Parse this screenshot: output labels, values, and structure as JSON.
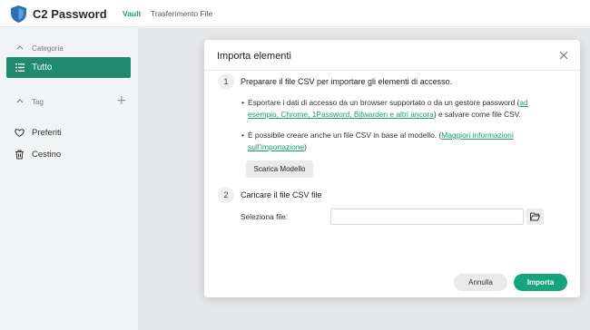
{
  "app": {
    "title": "C2 Password",
    "nav": [
      "Vault",
      "Trasferimento File"
    ]
  },
  "sidebar": {
    "category_header": "Categoria",
    "active_item": "Tutto",
    "tag_header": "Tag",
    "items": [
      {
        "label": "Preferiti",
        "icon": "heart-icon"
      },
      {
        "label": "Cestino",
        "icon": "trash-icon"
      }
    ]
  },
  "modal": {
    "title": "Importa elementi",
    "step1": {
      "num": "1",
      "title": "Preparare il file CSV per importare gli elementi di accesso.",
      "bullet1_pre": "Esportare i dati di accesso da un browser supportato o da un gestore password (",
      "bullet1_link": "ad esempio, Chrome, 1Password, Bitwarden e altri ancora",
      "bullet1_post": ") e salvare come file CSV.",
      "bullet2_pre": "È possibile creare anche un file CSV in base al modello. (",
      "bullet2_link": "Maggiori informazioni sull'importazione",
      "bullet2_post": ")",
      "template_button": "Scarica Modello"
    },
    "step2": {
      "num": "2",
      "title": "Caricare il file CSV file",
      "file_label": "Seleziona file:",
      "file_value": ""
    },
    "cancel_button": "Annulla",
    "import_button": "Importa"
  },
  "colors": {
    "accent": "#1a9b79",
    "sidebar_active": "#1f8a6c",
    "import_button": "#18a37f"
  }
}
